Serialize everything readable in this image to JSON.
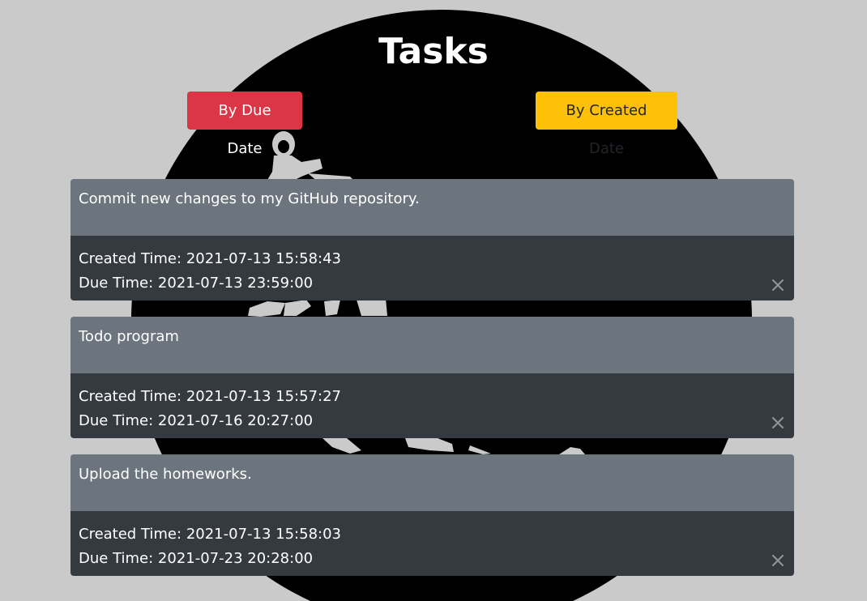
{
  "page": {
    "title": "Tasks"
  },
  "sort": {
    "by_due_label": "By Due Date",
    "by_created_label": "By Created Date"
  },
  "tasks": [
    {
      "title": "Commit new changes to my GitHub repository.",
      "created_label": "Created Time:",
      "created": "2021-07-13 15:58:43",
      "due_label": "Due Time:",
      "due": "2021-07-13 23:59:00"
    },
    {
      "title": "Todo program",
      "created_label": "Created Time:",
      "created": "2021-07-13 15:57:27",
      "due_label": "Due Time:",
      "due": "2021-07-16 20:27:00"
    },
    {
      "title": "Upload the homeworks.",
      "created_label": "Created Time:",
      "created": "2021-07-13 15:58:03",
      "due_label": "Due Time:",
      "due": "2021-07-23 20:28:00"
    }
  ],
  "icons": {
    "delete": "close-icon",
    "background": "dancer-emblem"
  },
  "colors": {
    "background": "#cacaca",
    "danger": "#dc3545",
    "warning": "#ffc107",
    "card_header": "#6c757d",
    "card_body": "#343a40"
  }
}
